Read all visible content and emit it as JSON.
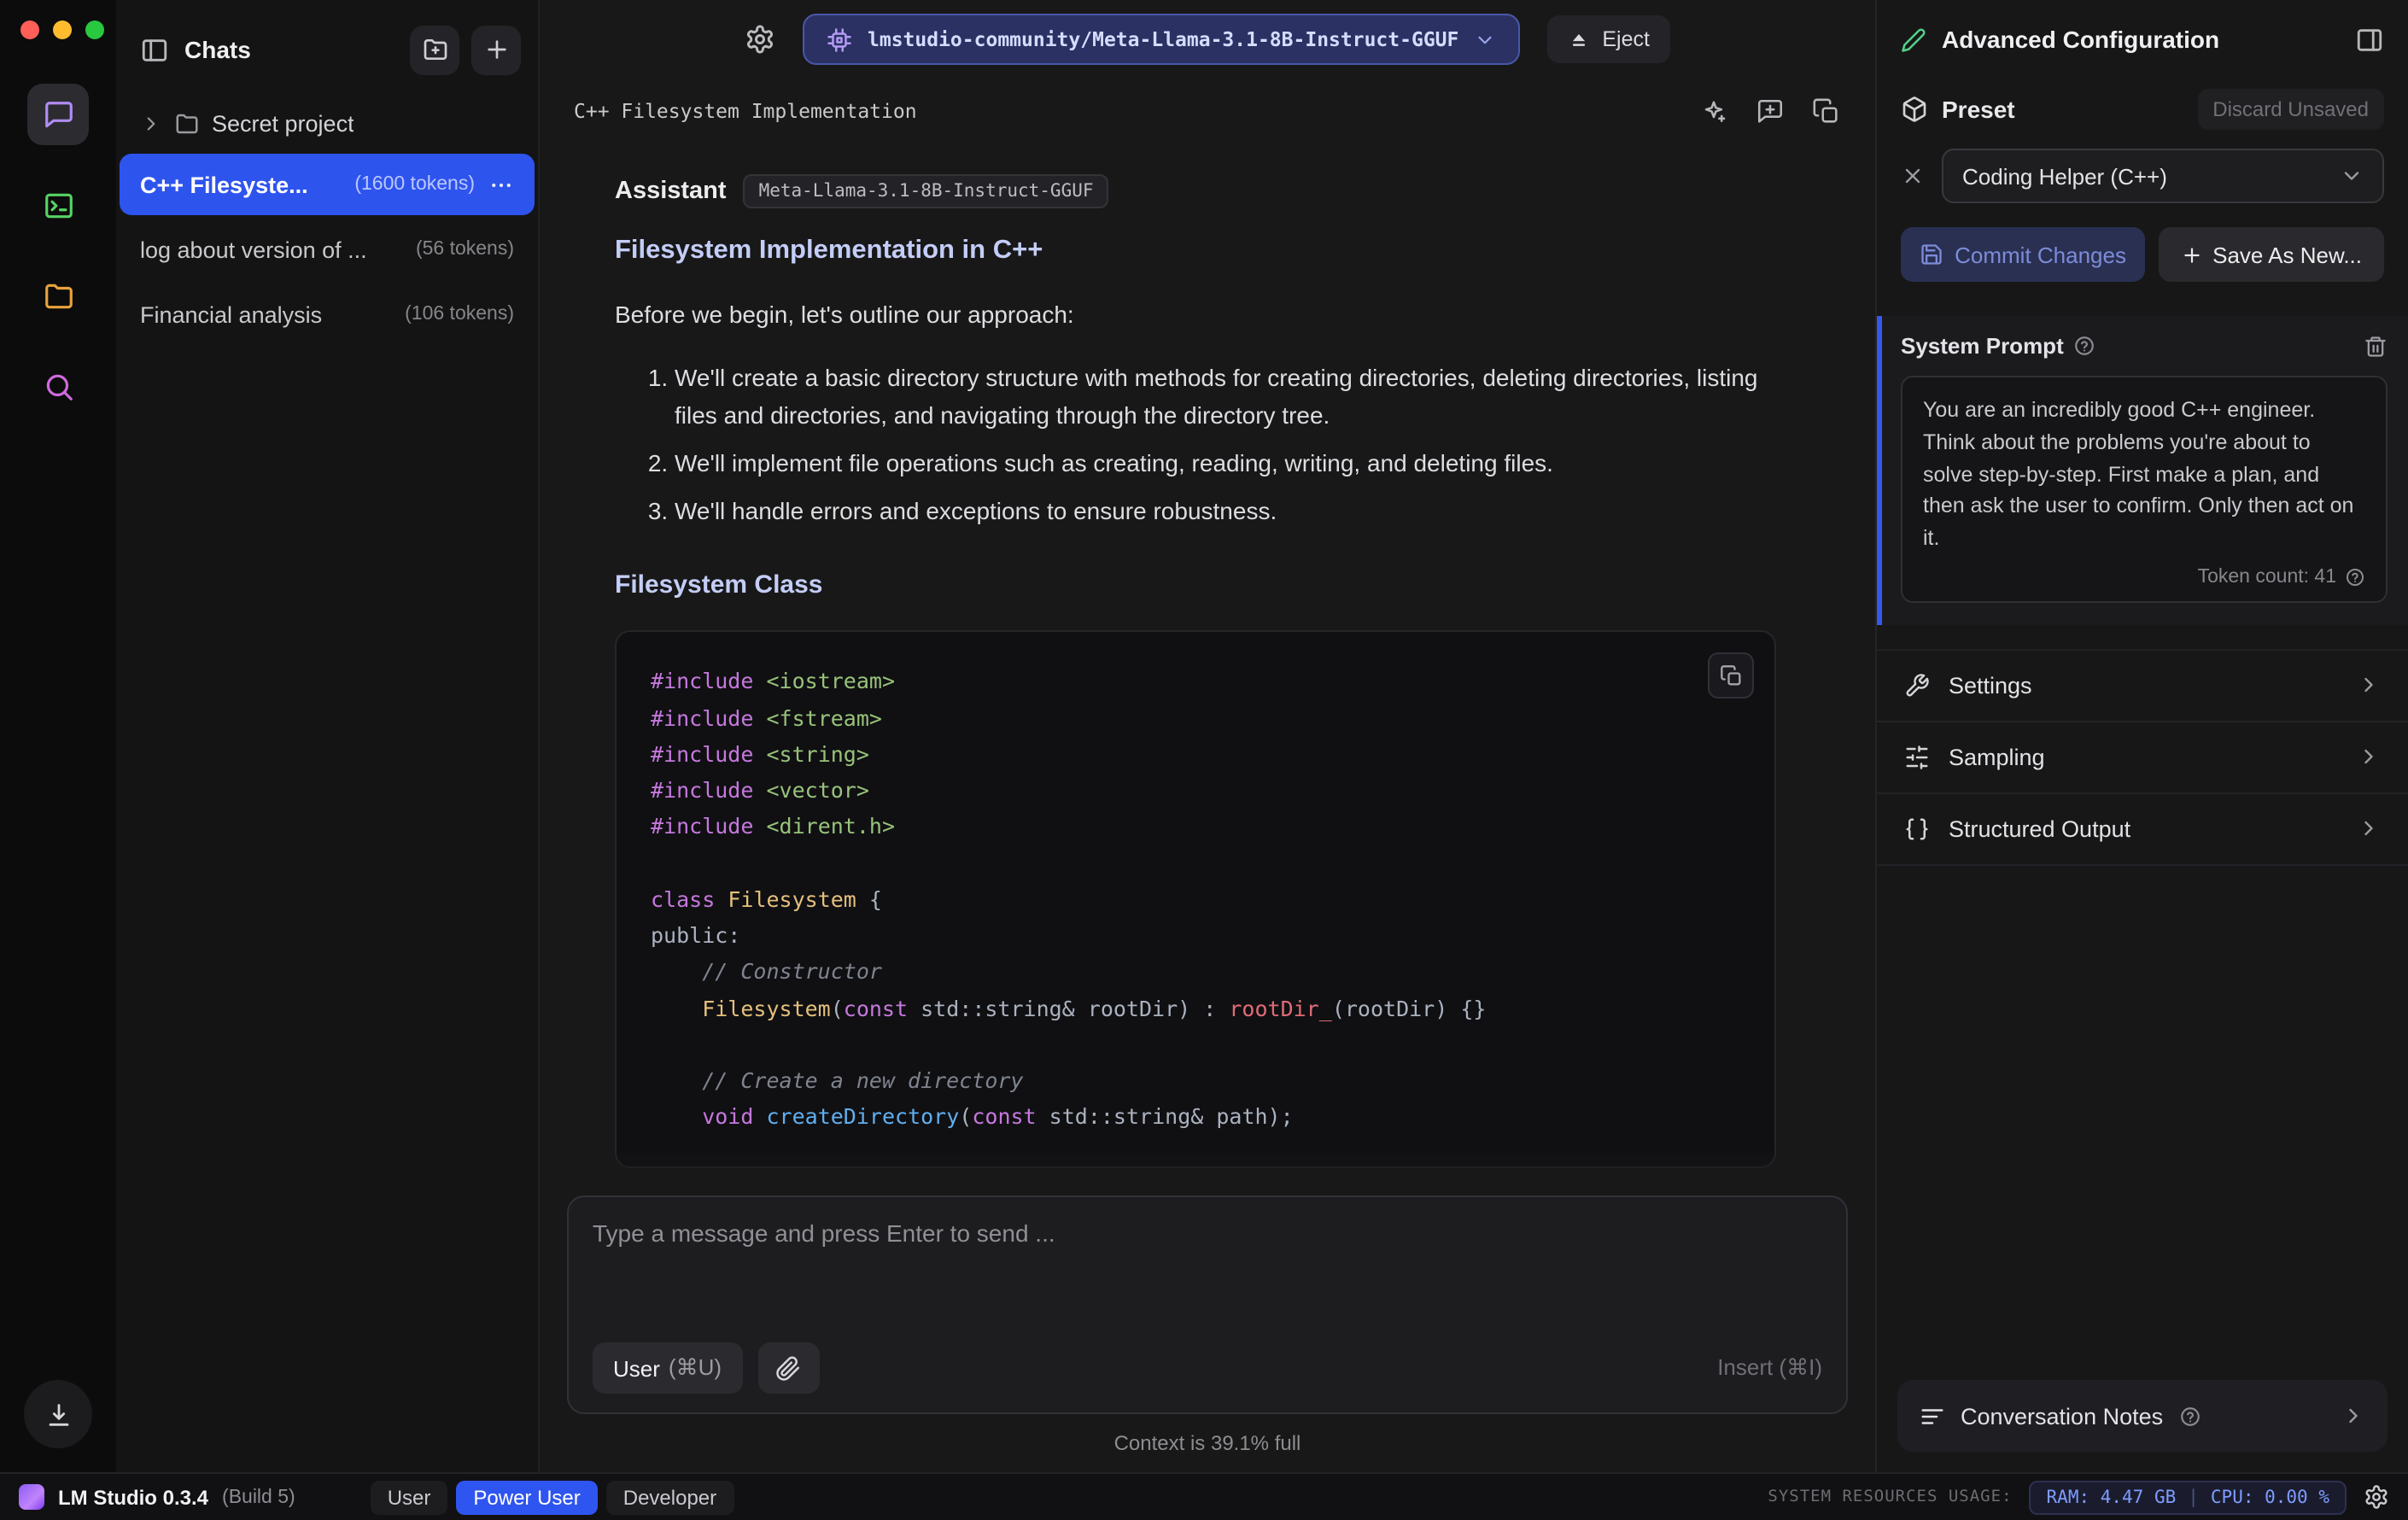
{
  "sidebar": {
    "title": "Chats",
    "folder_label": "Secret project",
    "chats": [
      {
        "label": "C++ Filesyste...",
        "tokens": "(1600 tokens)"
      },
      {
        "label": "log about version of ...",
        "tokens": "(56 tokens)"
      },
      {
        "label": "Financial analysis",
        "tokens": "(106 tokens)"
      }
    ]
  },
  "header": {
    "model_name": "lmstudio-community/Meta-Llama-3.1-8B-Instruct-GGUF",
    "eject_label": "Eject"
  },
  "chat": {
    "title": "C++ Filesystem Implementation",
    "assistant_label": "Assistant",
    "model_badge": "Meta-Llama-3.1-8B-Instruct-GGUF",
    "heading_1": "Filesystem Implementation in C++",
    "intro": "Before we begin, let's outline our approach:",
    "list_items": [
      "We'll create a basic directory structure with methods for creating directories, deleting directories, listing files and directories, and navigating through the directory tree.",
      "We'll implement file operations such as creating, reading, writing, and deleting files.",
      "We'll handle errors and exceptions to ensure robustness."
    ],
    "heading_2": "Filesystem Class",
    "code_lines": [
      [
        {
          "c": "k",
          "t": "#include"
        },
        {
          "c": "p",
          "t": " "
        },
        {
          "c": "s",
          "t": "<iostream>"
        }
      ],
      [
        {
          "c": "k",
          "t": "#include"
        },
        {
          "c": "p",
          "t": " "
        },
        {
          "c": "s",
          "t": "<fstream>"
        }
      ],
      [
        {
          "c": "k",
          "t": "#include"
        },
        {
          "c": "p",
          "t": " "
        },
        {
          "c": "s",
          "t": "<string>"
        }
      ],
      [
        {
          "c": "k",
          "t": "#include"
        },
        {
          "c": "p",
          "t": " "
        },
        {
          "c": "s",
          "t": "<vector>"
        }
      ],
      [
        {
          "c": "k",
          "t": "#include"
        },
        {
          "c": "p",
          "t": " "
        },
        {
          "c": "s",
          "t": "<dirent.h>"
        }
      ],
      [],
      [
        {
          "c": "k",
          "t": "class"
        },
        {
          "c": "p",
          "t": " "
        },
        {
          "c": "t",
          "t": "Filesystem"
        },
        {
          "c": "p",
          "t": " {"
        }
      ],
      [
        {
          "c": "p",
          "t": "public:"
        }
      ],
      [
        {
          "c": "c",
          "t": "    // Constructor"
        }
      ],
      [
        {
          "c": "t",
          "t": "    Filesystem"
        },
        {
          "c": "p",
          "t": "("
        },
        {
          "c": "k",
          "t": "const"
        },
        {
          "c": "p",
          "t": " std::string& rootDir) : "
        },
        {
          "c": "v",
          "t": "rootDir_"
        },
        {
          "c": "p",
          "t": "(rootDir) {}"
        }
      ],
      [],
      [
        {
          "c": "c",
          "t": "    // Create a new directory"
        }
      ],
      [
        {
          "c": "k",
          "t": "    void"
        },
        {
          "c": "p",
          "t": " "
        },
        {
          "c": "f",
          "t": "createDirectory"
        },
        {
          "c": "p",
          "t": "("
        },
        {
          "c": "k",
          "t": "const"
        },
        {
          "c": "p",
          "t": " std::string& path);"
        }
      ]
    ],
    "composer": {
      "placeholder": "Type a message and press Enter to send ...",
      "user_button": "User",
      "user_shortcut": "(⌘U)",
      "insert_label": "Insert (⌘I)"
    },
    "context_status": "Context is 39.1% full"
  },
  "panel": {
    "title": "Advanced Configuration",
    "preset": {
      "label": "Preset",
      "discard_label": "Discard Unsaved",
      "selected": "Coding Helper (C++)",
      "commit_label": "Commit Changes",
      "save_as_label": "Save As New..."
    },
    "system_prompt": {
      "label": "System Prompt",
      "text": "You are an incredibly good C++ engineer. Think about the problems you're about to solve step-by-step. First make a plan, and then ask the user to confirm. Only then act on it.",
      "token_count": "Token count: 41"
    },
    "sections": [
      "Settings",
      "Sampling",
      "Structured Output"
    ],
    "notes_label": "Conversation Notes"
  },
  "statusbar": {
    "app_name": "LM Studio 0.3.4",
    "build": "(Build 5)",
    "modes": [
      "User",
      "Power User",
      "Developer"
    ],
    "resources_label": "SYSTEM RESOURCES USAGE:",
    "ram_label": "RAM: 4.47 GB",
    "cpu_label": "CPU: 0.00 %"
  }
}
